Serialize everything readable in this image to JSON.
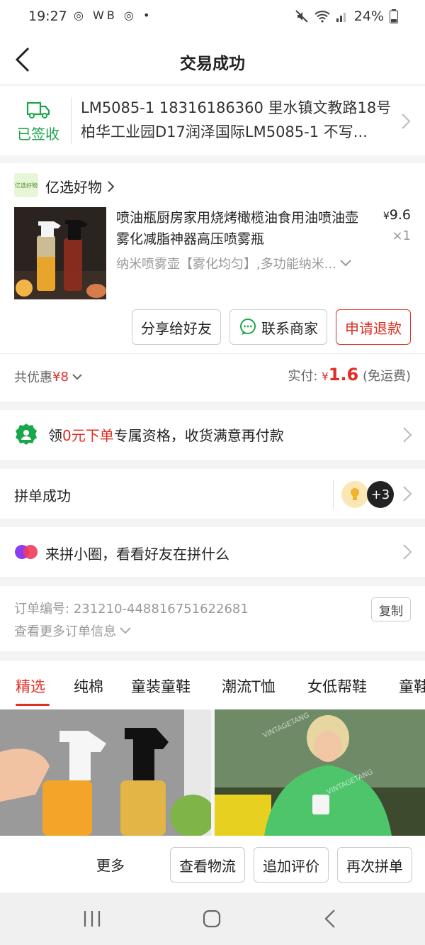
{
  "status_bar": {
    "time": "19:27",
    "app_icons": "◎ WB ◎ •",
    "battery": "24%"
  },
  "header": {
    "title": "交易成功"
  },
  "address": {
    "status_label": "已签收",
    "text": "LM5085-1 18316186360 里水镇文教路18号柏华工业园D17润泽国际LM5085-1 不写..."
  },
  "store": {
    "name": "亿选好物",
    "logo_text": "亿选好物",
    "product_title": "喷油瓶厨房家用烧烤橄榄油食用油喷油壶雾化减脂神器高压喷雾瓶",
    "price_symbol": "¥",
    "price": "9.6",
    "qty": "×1",
    "spec": "纳米喷雾壶【雾化均匀】,多功能纳米...",
    "buttons": {
      "share": "分享给好友",
      "contact": "联系商家",
      "refund": "申请退款"
    },
    "discount_label": "共优惠",
    "discount_amount": "¥8",
    "paid_label": "实付:",
    "paid_symbol": "¥",
    "paid_amount": "1.6",
    "paid_note": "(免运费)"
  },
  "promo": {
    "prefix": "领",
    "highlight": "0元下单",
    "suffix": "专属资格，收货满意再付款"
  },
  "group": {
    "label": "拼单成功",
    "extra_count": "+3"
  },
  "circle": {
    "label": "来拼小圈，看看好友在拼什么"
  },
  "order": {
    "number_label": "订单编号:",
    "number": "231210-448816751622681",
    "more": "查看更多订单信息",
    "copy": "复制"
  },
  "tabs": [
    "精选",
    "纯棉",
    "童装童鞋",
    "潮流T恤",
    "女低帮鞋",
    "童鞋"
  ],
  "products": {
    "watermark": "VINTAGETANG"
  },
  "actions": {
    "more": "更多",
    "logistics": "查看物流",
    "review": "追加评价",
    "reorder": "再次拼单"
  },
  "colors": {
    "accent_red": "#e02e24",
    "success_green": "#1aa64a"
  }
}
